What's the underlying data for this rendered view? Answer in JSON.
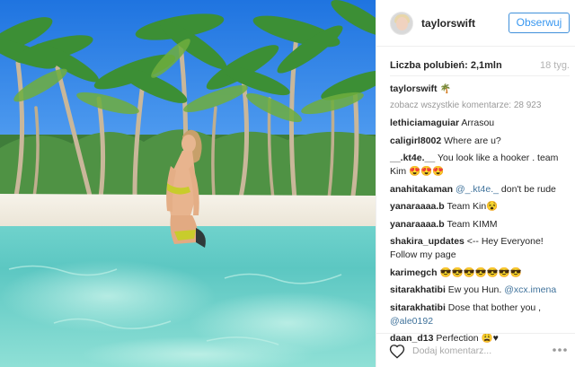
{
  "post": {
    "author": "taylorswift",
    "follow_label": "Obserwuj",
    "likes_label": "Liczba polubień: 2,1mln",
    "time_ago": "18 tyg.",
    "caption_user": "taylorswift",
    "caption_emoji": "🌴",
    "view_all_label": "zobacz wszystkie komentarze: 28 923"
  },
  "comments": [
    {
      "user": "lethiciamaguiar",
      "text": "Arrasou"
    },
    {
      "user": "caligirl8002",
      "text": "Where are u?"
    },
    {
      "user": "__.kt4e.__",
      "text": "You look like a hooker . team Kim 😍😍😍"
    },
    {
      "user": "anahitakaman",
      "mention": "@_.kt4e._",
      "text": "don't be rude"
    },
    {
      "user": "yanaraaaa.b",
      "text": "Team Kin😵"
    },
    {
      "user": "yanaraaaa.b",
      "text": "Team KIMM"
    },
    {
      "user": "shakira_updates",
      "text": "<-- Hey Everyone! Follow my page"
    },
    {
      "user": "karimegch",
      "text": "😎😎😎😎😎😎😎"
    },
    {
      "user": "sitarakhatibi",
      "text": "Ew you Hun.",
      "mention": "@xcx.imena"
    },
    {
      "user": "sitarakhatibi",
      "text": "Dose that bother you ,",
      "mention": "@ale0192"
    },
    {
      "user": "daan_d13",
      "text": "Perfection 😩♥"
    }
  ],
  "footer": {
    "add_comment_placeholder": "Dodaj komentarz..."
  },
  "icons": {
    "heart": "heart-icon",
    "more": "more-options-icon",
    "palm": "palm-tree-emoji"
  },
  "colors": {
    "follow_blue": "#3897f0",
    "mention_blue": "#3f729b",
    "muted_gray": "#999999"
  }
}
